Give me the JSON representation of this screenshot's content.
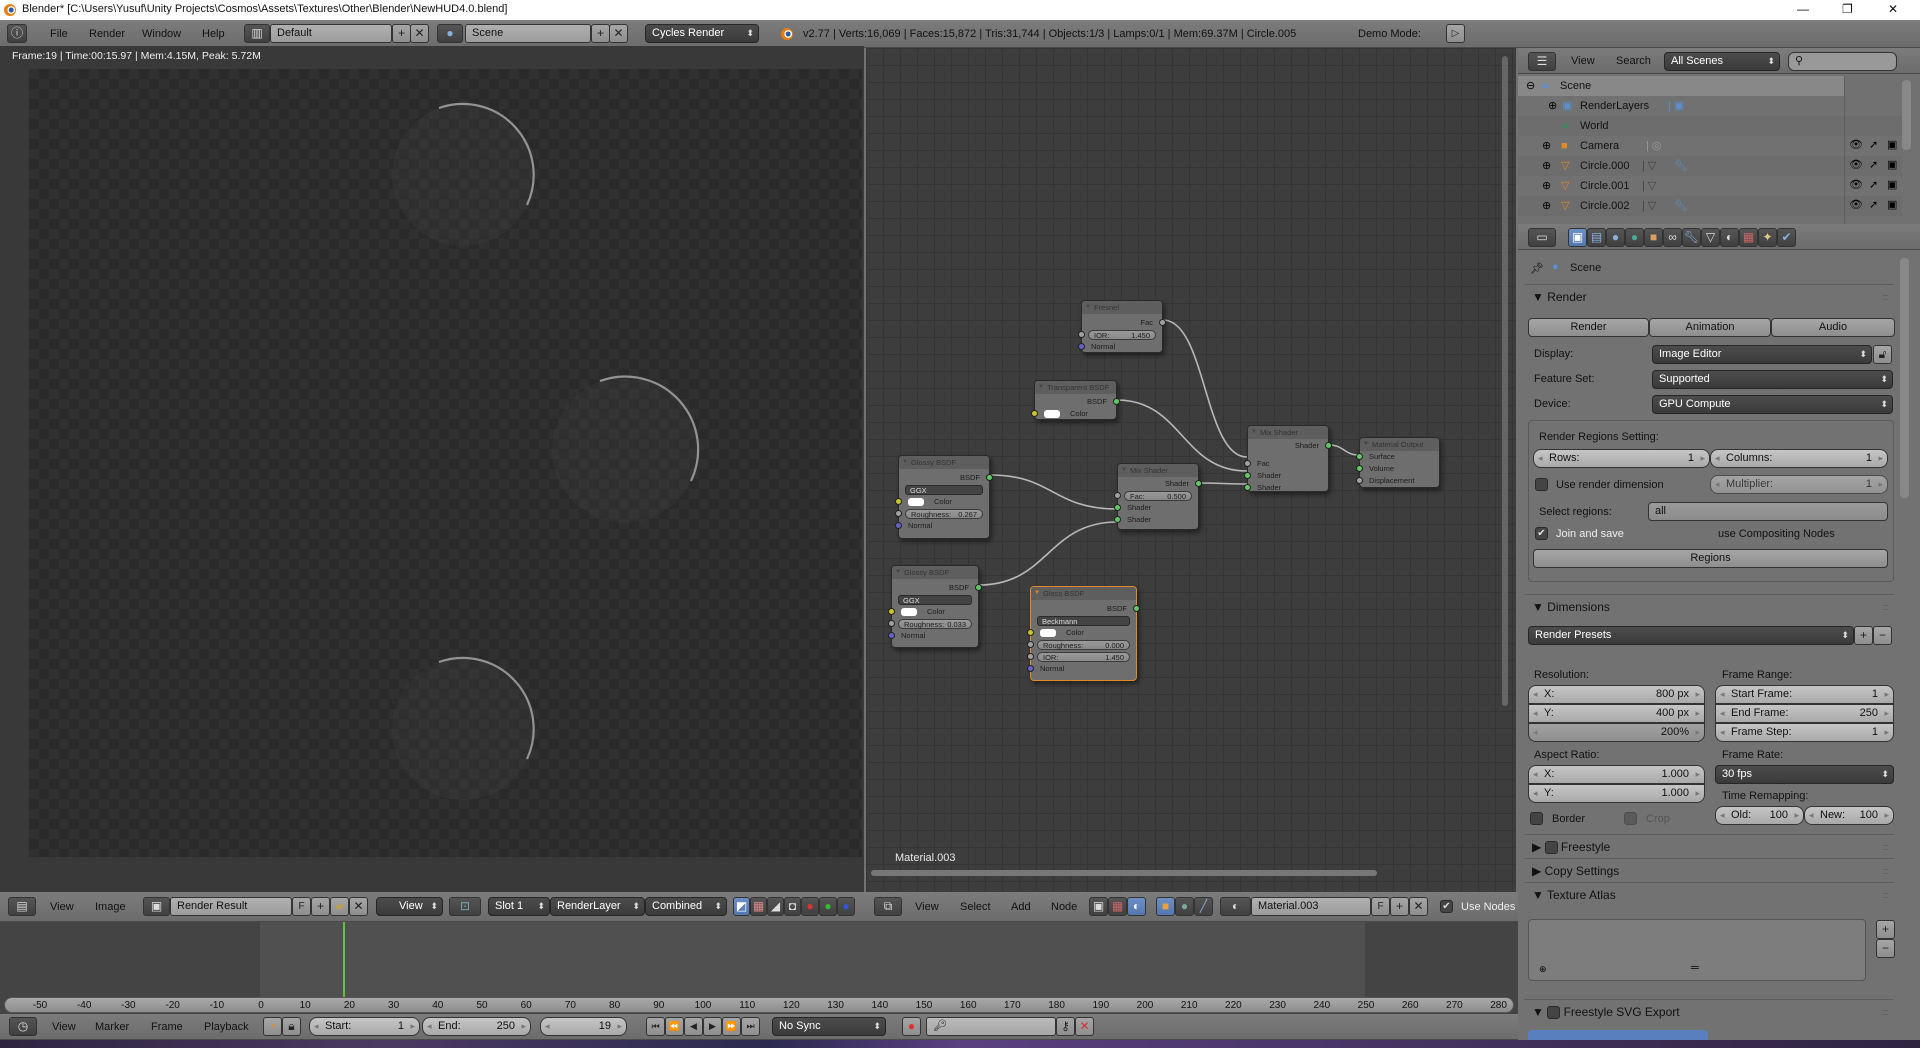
{
  "window": {
    "title": "Blender* [C:\\Users\\Yusuf\\Unity Projects\\Cosmos\\Assets\\Textures\\Other\\Blender\\NewHUD4.0.blend]",
    "minimize": "—",
    "maximize": "❐",
    "close": "✕"
  },
  "info_header": {
    "menus": [
      "File",
      "Render",
      "Window",
      "Help"
    ],
    "layout": "Default",
    "scene": "Scene",
    "engine": "Cycles Render",
    "stats": "v2.77 | Verts:16,069 | Faces:15,872 | Tris:31,744 | Objects:1/3 | Lamps:0/1 | Mem:69.37M | Circle.005",
    "demo_mode": "Demo Mode:"
  },
  "image_editor": {
    "render_info": "Frame:19 | Time:00:15.97 | Mem:4.15M, Peak: 5.72M",
    "header": {
      "menus": [
        "View",
        "Image"
      ],
      "image": "Render Result",
      "fake_user": "F",
      "view": "View",
      "slot": "Slot 1",
      "layer": "RenderLayer",
      "pass": "Combined"
    }
  },
  "node_editor": {
    "material_label": "Material.003",
    "header": {
      "menus": [
        "View",
        "Select",
        "Add",
        "Node"
      ],
      "material": "Material.003",
      "fake_user": "F",
      "use_nodes": "Use Nodes",
      "use_nodes_checked": true
    },
    "nodes": {
      "fresnel": {
        "title": "Fresnel",
        "out": "Fac",
        "ior_label": "IOR:",
        "ior": "1.450",
        "normal": "Normal"
      },
      "transparent": {
        "title": "Transparent BSDF",
        "out": "BSDF",
        "color": "Color"
      },
      "glossy1": {
        "title": "Glossy BSDF",
        "out": "BSDF",
        "distribution": "GGX",
        "color": "Color",
        "roughness_label": "Roughness:",
        "roughness": "0.267",
        "normal": "Normal"
      },
      "glossy2": {
        "title": "Glossy BSDF",
        "out": "BSDF",
        "distribution": "GGX",
        "color": "Color",
        "roughness_label": "Roughness:",
        "roughness": "0.033",
        "normal": "Normal"
      },
      "glass": {
        "title": "Glass BSDF",
        "out": "BSDF",
        "distribution": "Beckmann",
        "color": "Color",
        "roughness_label": "Roughness:",
        "roughness": "0.000",
        "ior_label": "IOR:",
        "ior": "1.450",
        "normal": "Normal"
      },
      "mix1": {
        "title": "Mix Shader",
        "out": "Shader",
        "fac_label": "Fac:",
        "fac": "0.500",
        "in1": "Shader",
        "in2": "Shader"
      },
      "mix2": {
        "title": "Mix Shader",
        "out": "Shader",
        "fac": "Fac",
        "in1": "Shader",
        "in2": "Shader"
      },
      "output": {
        "title": "Material Output",
        "surface": "Surface",
        "volume": "Volume",
        "displacement": "Displacement"
      }
    }
  },
  "outliner": {
    "menus": [
      "View",
      "Search"
    ],
    "filter": "All Scenes",
    "search_placeholder": "",
    "items": [
      {
        "name": "Scene"
      },
      {
        "name": "RenderLayers"
      },
      {
        "name": "World"
      },
      {
        "name": "Camera"
      },
      {
        "name": "Circle.000"
      },
      {
        "name": "Circle.001"
      },
      {
        "name": "Circle.002"
      }
    ]
  },
  "properties": {
    "breadcrumb": "Scene",
    "render_panel": {
      "title": "Render",
      "buttons": [
        "Render",
        "Animation",
        "Audio"
      ],
      "display_label": "Display:",
      "display": "Image Editor",
      "feature_set_label": "Feature Set:",
      "feature_set": "Supported",
      "device_label": "Device:",
      "device": "GPU Compute",
      "regions_title": "Render Regions Setting:",
      "rows_label": "Rows:",
      "rows": "1",
      "columns_label": "Columns:",
      "columns": "1",
      "use_render_dimension": "Use render dimension",
      "use_render_dimension_checked": false,
      "multiplier_label": "Multiplier:",
      "multiplier": "1",
      "select_regions_label": "Select regions:",
      "select_regions": "all",
      "join_and_save": "Join and save",
      "join_and_save_checked": true,
      "use_compositing": "use Compositing Nodes",
      "regions_button": "Regions"
    },
    "dimensions_panel": {
      "title": "Dimensions",
      "presets": "Render Presets",
      "resolution_label": "Resolution:",
      "res_x_label": "X:",
      "res_x": "800 px",
      "res_y_label": "Y:",
      "res_y": "400 px",
      "res_percent": "200%",
      "aspect_label": "Aspect Ratio:",
      "aspect_x_label": "X:",
      "aspect_x": "1.000",
      "aspect_y_label": "Y:",
      "aspect_y": "1.000",
      "border": "Border",
      "crop": "Crop",
      "frame_range_label": "Frame Range:",
      "start_label": "Start Frame:",
      "start": "1",
      "end_label": "End Frame:",
      "end": "250",
      "step_label": "Frame Step:",
      "step": "1",
      "frame_rate_label": "Frame Rate:",
      "frame_rate": "30 fps",
      "time_remap_label": "Time Remapping:",
      "old_label": "Old:",
      "old": "100",
      "new_label": "New:",
      "new": "100"
    },
    "collapsed_panels": {
      "freestyle": "Freestyle",
      "copy_settings": "Copy Settings",
      "texture_atlas": "Texture Atlas",
      "freestyle_svg": "Freestyle SVG Export"
    }
  },
  "timeline": {
    "ticks": [
      -50,
      -40,
      -30,
      -20,
      -10,
      0,
      10,
      20,
      30,
      40,
      50,
      60,
      70,
      80,
      90,
      100,
      110,
      120,
      130,
      140,
      150,
      160,
      170,
      180,
      190,
      200,
      210,
      220,
      230,
      240,
      250,
      260,
      270,
      280
    ],
    "current_frame": 19,
    "scene_start": 1,
    "scene_end": 250,
    "header": {
      "menus": [
        "View",
        "Marker",
        "Frame",
        "Playback"
      ],
      "start_label": "Start:",
      "start": "1",
      "end_label": "End:",
      "end": "250",
      "current": "19",
      "sync": "No Sync"
    }
  }
}
